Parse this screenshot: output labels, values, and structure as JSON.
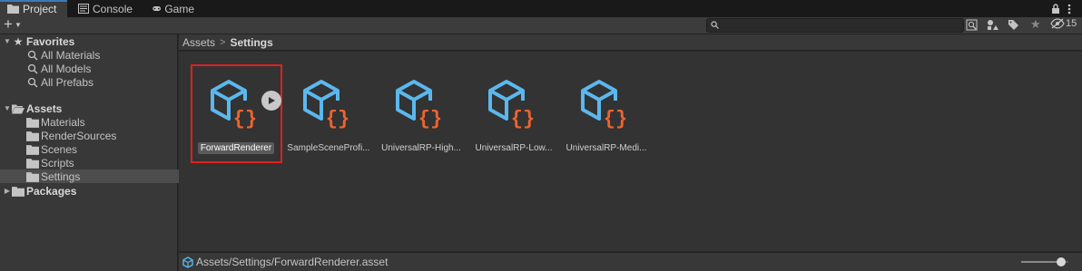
{
  "tabs": [
    {
      "label": "Project",
      "icon": "folder-icon",
      "active": true
    },
    {
      "label": "Console",
      "icon": "console-icon",
      "active": false
    },
    {
      "label": "Game",
      "icon": "gamepad-icon",
      "active": false
    }
  ],
  "toolbar": {
    "add_label": "+",
    "search_value": "",
    "hidden_count": "15"
  },
  "sidebar": {
    "favorites": {
      "label": "Favorites",
      "items": [
        "All Materials",
        "All Models",
        "All Prefabs"
      ]
    },
    "assets": {
      "label": "Assets",
      "items": [
        "Materials",
        "RenderSources",
        "Scenes",
        "Scripts",
        "Settings"
      ],
      "selected": "Settings"
    },
    "packages": {
      "label": "Packages"
    }
  },
  "breadcrumb": {
    "root": "Assets",
    "separator": ">",
    "current": "Settings"
  },
  "assets": [
    {
      "label": "ForwardRenderer",
      "selected": true
    },
    {
      "label": "SampleSceneProfi..."
    },
    {
      "label": "UniversalRP-High..."
    },
    {
      "label": "UniversalRP-Low..."
    },
    {
      "label": "UniversalRP-Medi..."
    }
  ],
  "status": {
    "path": "Assets/Settings/ForwardRenderer.asset",
    "zoom": 0.85
  },
  "colors": {
    "cube": "#5bb8ee",
    "braces": "#ee6430",
    "selection_outline": "#e02020",
    "accent": "#3a79bb"
  }
}
